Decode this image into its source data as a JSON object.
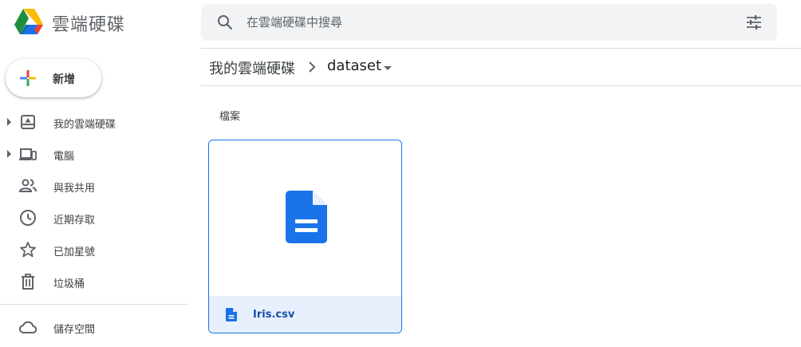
{
  "app": {
    "title": "雲端硬碟"
  },
  "search": {
    "placeholder": "在雲端硬碟中搜尋"
  },
  "icons": {
    "logo": "google-drive-logo",
    "search": "search-icon",
    "filter": "tune-icon",
    "new": "plus-icon",
    "file": "document-icon"
  },
  "colors": {
    "accent": "#1a73e8",
    "selected_bg": "#e8f0fe",
    "file_icon": "#1a73e8"
  },
  "sidebar": {
    "new_label": "新增",
    "items": [
      {
        "label": "我的雲端硬碟",
        "icon": "my-drive-icon",
        "expandable": true
      },
      {
        "label": "電腦",
        "icon": "computers-icon",
        "expandable": true
      },
      {
        "label": "與我共用",
        "icon": "shared-icon",
        "expandable": false
      },
      {
        "label": "近期存取",
        "icon": "clock-icon",
        "expandable": false
      },
      {
        "label": "已加星號",
        "icon": "star-icon",
        "expandable": false
      },
      {
        "label": "垃圾桶",
        "icon": "trash-icon",
        "expandable": false
      }
    ],
    "storage_label": "儲存空間"
  },
  "breadcrumb": {
    "root": "我的雲端硬碟",
    "current": "dataset"
  },
  "main": {
    "section_title": "檔案",
    "files": [
      {
        "name": "Iris.csv"
      }
    ]
  }
}
